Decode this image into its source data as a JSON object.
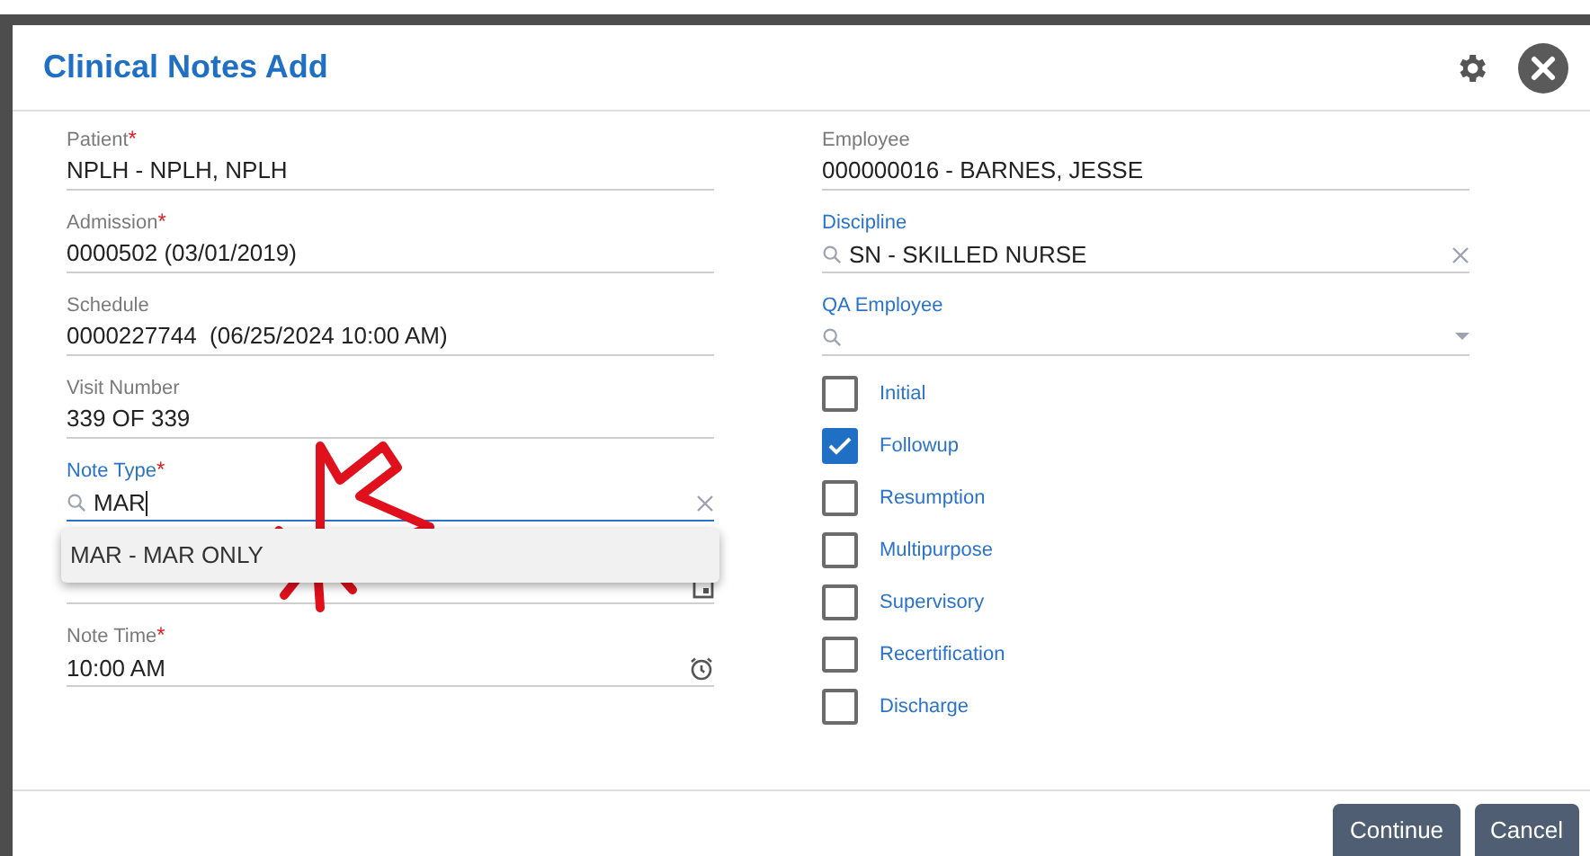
{
  "dialog": {
    "title": "Clinical Notes Add"
  },
  "left_fields": [
    {
      "kind": "static",
      "label": "Patient",
      "required_mark": "*",
      "accent": false,
      "value": "NPLH - NPLH, NPLH"
    },
    {
      "kind": "static",
      "label": "Admission",
      "required_mark": "*",
      "accent": false,
      "value": "0000502 (03/01/2019)"
    },
    {
      "kind": "static",
      "label": "Schedule",
      "accent": false,
      "value": "0000227744  (06/25/2024 10:00 AM)"
    },
    {
      "kind": "static",
      "label": "Visit Number",
      "accent": false,
      "value": "339 OF 339"
    },
    {
      "kind": "search",
      "label": "Note Type",
      "required_mark": "*",
      "accent": true,
      "focused": true,
      "value": "MAR",
      "options": [
        "MAR - MAR ONLY"
      ]
    },
    {
      "kind": "date"
    },
    {
      "kind": "time",
      "label": "Note Time",
      "required_mark": "*",
      "accent": false,
      "value": "10:00 AM"
    }
  ],
  "right_fields": [
    {
      "kind": "static",
      "label": "Employee",
      "accent": false,
      "value": "000000016 - BARNES, JESSE"
    },
    {
      "kind": "search",
      "label": "Discipline",
      "accent": true,
      "focused": false,
      "value": "SN - SKILLED NURSE"
    },
    {
      "kind": "select",
      "label": "QA Employee",
      "accent": true
    }
  ],
  "checkboxes": [
    {
      "label": "Initial",
      "checked": false
    },
    {
      "label": "Followup",
      "checked": true
    },
    {
      "label": "Resumption",
      "checked": false
    },
    {
      "label": "Multipurpose",
      "checked": false
    },
    {
      "label": "Supervisory",
      "checked": false
    },
    {
      "label": "Recertification",
      "checked": false
    },
    {
      "label": "Discharge",
      "checked": false
    }
  ],
  "buttons": [
    "Continue",
    "Cancel"
  ]
}
